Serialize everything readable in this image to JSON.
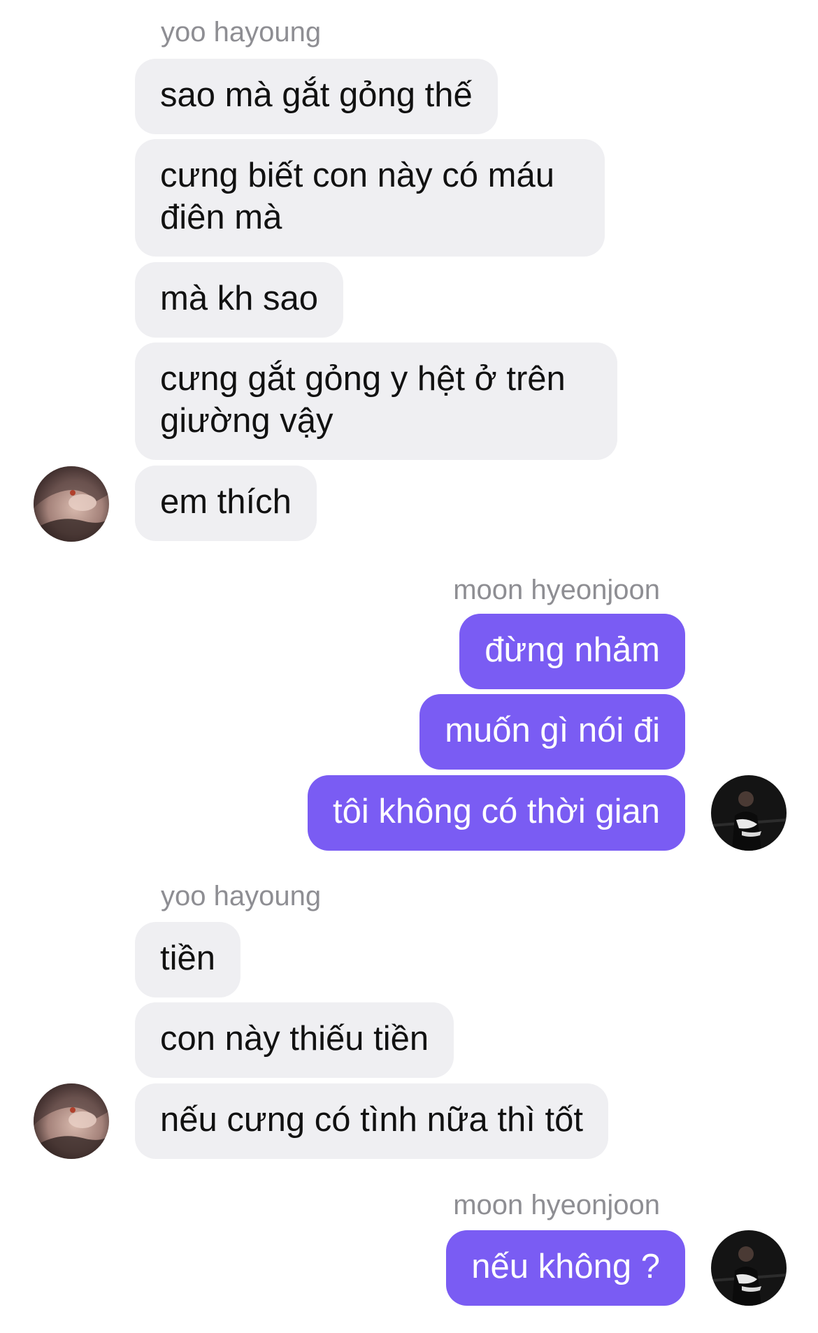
{
  "participants": {
    "left_name": "yoo hayoung",
    "right_name": "moon hyeonjoon"
  },
  "groups": [
    {
      "sender": "yoo hayoung",
      "side": "left",
      "messages": [
        "sao mà gắt gỏng thế",
        "cưng biết con này có máu điên mà",
        "mà kh sao",
        "cưng gắt gỏng y hệt ở trên giường vậy",
        "em thích"
      ]
    },
    {
      "sender": "moon hyeonjoon",
      "side": "right",
      "messages": [
        "đừng nhảm",
        "muốn gì nói đi",
        "tôi không có thời gian"
      ]
    },
    {
      "sender": "yoo hayoung",
      "side": "left",
      "messages": [
        "tiền",
        "con này thiếu tiền",
        "nếu cưng có tình nữa thì tốt"
      ]
    },
    {
      "sender": "moon hyeonjoon",
      "side": "right",
      "messages": [
        "nếu không ?"
      ]
    }
  ],
  "colors": {
    "incoming_bubble": "#efeff2",
    "outgoing_bubble": "#7a5cf3",
    "sender_name": "#8e8e93"
  },
  "icons": {
    "left_avatar": "avatar-photo-yoo-hayoung",
    "right_avatar": "avatar-photo-moon-hyeonjoon"
  }
}
